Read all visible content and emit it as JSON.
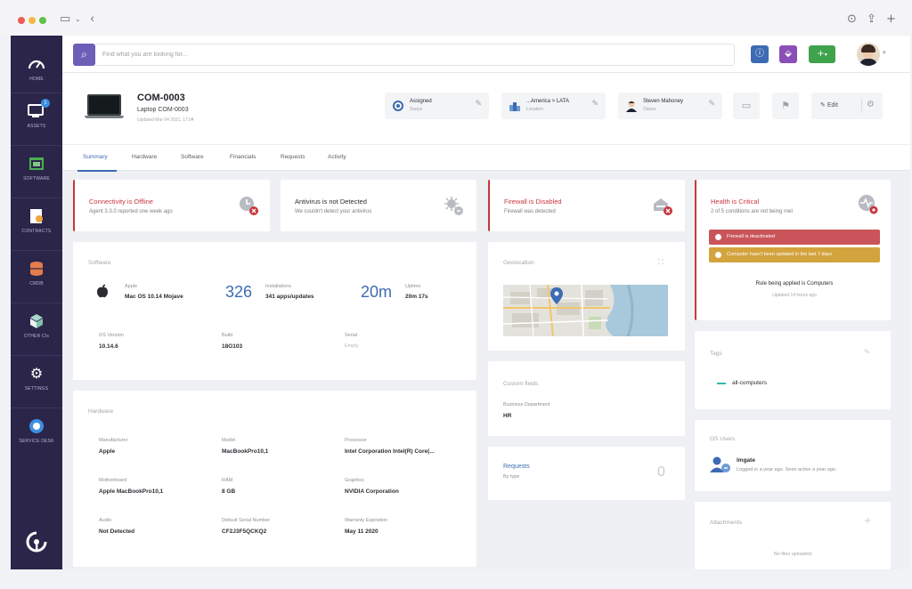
{
  "search": {
    "placeholder": "Find what you are looking for..."
  },
  "sidebar": {
    "items": [
      {
        "label": "HOME",
        "icon": "gauge-icon"
      },
      {
        "label": "ASSETS",
        "icon": "monitor-icon",
        "badge": "1"
      },
      {
        "label": "SOFTWARE",
        "icon": "software-icon"
      },
      {
        "label": "CONTRACTS",
        "icon": "contract-icon"
      },
      {
        "label": "CMDB",
        "icon": "database-icon"
      },
      {
        "label": "OTHER CIs",
        "icon": "boxes-icon"
      },
      {
        "label": "SETTINGS",
        "icon": "gear-icon"
      },
      {
        "label": "SERVICE DESK",
        "icon": "service-desk-icon"
      }
    ]
  },
  "asset": {
    "name": "COM-0003",
    "subtitle": "Laptop COM-0003",
    "updated": "Updated Mar 04 2021, 17:04"
  },
  "chips": {
    "status": {
      "title": "Assigned",
      "sub": "Status"
    },
    "location": {
      "title": "...America > LATA",
      "sub": "Location"
    },
    "owner": {
      "title": "Steven Mahoney",
      "sub": "Owner"
    }
  },
  "edit_label": "Edit",
  "tabs": [
    "Summary",
    "Hardware",
    "Software",
    "Financials",
    "Requests",
    "Activity"
  ],
  "status_cards": {
    "connectivity": {
      "title": "Connectivity is Offline",
      "sub": "Agent 3.3.0 reported one week ago"
    },
    "antivirus": {
      "title": "Antivirus is not Detected",
      "sub": "We couldn't detect your antivirus"
    },
    "firewall": {
      "title": "Firewall is Disabled",
      "sub": "Firewall was detected"
    },
    "health": {
      "title": "Health is Critical",
      "sub": "2 of 5 conditions are not being met"
    }
  },
  "health_alerts": [
    {
      "text": "Firewall is deactivated",
      "color": "#c9545a"
    },
    {
      "text": "Computer hasn't been updated in the last 7 days",
      "color": "#d3a33d"
    }
  ],
  "health_rule": {
    "text": "Rule being applied is Computers",
    "updated": "Updated 14 hours ago"
  },
  "software": {
    "heading": "Software",
    "os_vendor": "Apple",
    "os_name": "Mac OS 10.14 Mojave",
    "installations_count": "326",
    "installations_label": "Installations",
    "installations_sub": "341 apps/updates",
    "uptime_value": "20m",
    "uptime_label": "Uptime",
    "uptime_sub": "20m 17s",
    "fields": [
      {
        "label": "OS Version",
        "value": "10.14.6"
      },
      {
        "label": "Build",
        "value": "18G103"
      },
      {
        "label": "Serial",
        "value": "Empty"
      }
    ]
  },
  "geolocation": {
    "heading": "Geolocation"
  },
  "custom_fields": {
    "heading": "Custom fields",
    "label": "Business Department",
    "value": "HR"
  },
  "requests": {
    "heading": "Requests",
    "sub": "By type",
    "count": "0"
  },
  "tags": {
    "heading": "Tags",
    "items": [
      "all-computers"
    ]
  },
  "os_users": {
    "heading": "OS Users",
    "name": "lmgate",
    "sub": "Logged in a year ago. Seen active a year ago."
  },
  "attachments": {
    "heading": "Attachments",
    "empty": "No files uploaded"
  },
  "hardware": {
    "heading": "Hardware",
    "fields": [
      {
        "label": "Manufacturer",
        "value": "Apple"
      },
      {
        "label": "Model",
        "value": "MacBookPro10,1"
      },
      {
        "label": "Processor",
        "value": "Intel Corporation Intel(R) Core(..."
      },
      {
        "label": "Motherboard",
        "value": "Apple MacBookPro10,1"
      },
      {
        "label": "RAM",
        "value": "8 GB"
      },
      {
        "label": "Graphics",
        "value": "NVIDIA Corporation"
      },
      {
        "label": "Audio",
        "value": "Not Detected"
      },
      {
        "label": "Default Serial Number",
        "value": "CF2J3F5QCKQ2"
      },
      {
        "label": "Warranty Expiration",
        "value": "May 11 2020"
      }
    ]
  },
  "colors": {
    "sidebar": "#2a2549",
    "accent": "#3d6bb3",
    "critical": "#c7373c",
    "search_btn": "#6d5fb8"
  }
}
